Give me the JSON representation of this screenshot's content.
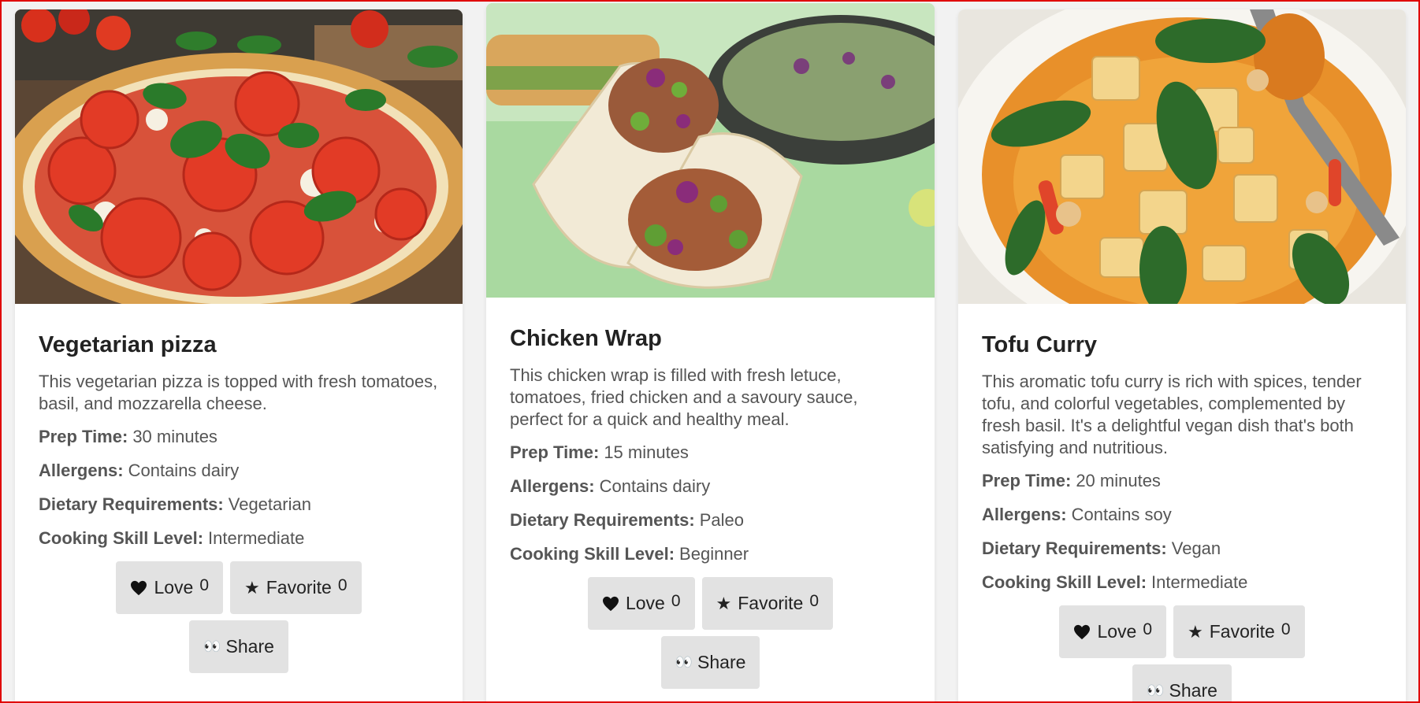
{
  "labels": {
    "prep": "Prep Time:",
    "allergens": "Allergens:",
    "diet": "Dietary Requirements:",
    "skill": "Cooking Skill Level:",
    "love": "Love",
    "favorite": "Favorite",
    "share": "Share"
  },
  "recipes": [
    {
      "title": "Vegetarian pizza",
      "description": "This vegetarian pizza is topped with fresh tomatoes, basil, and mozzarella cheese.",
      "prep_time": "30 minutes",
      "allergens": "Contains dairy",
      "dietary": "Vegetarian",
      "skill": "Intermediate",
      "love_count": "0",
      "favorite_count": "0",
      "image_icon": "pizza-photo"
    },
    {
      "title": "Chicken Wrap",
      "description": "This chicken wrap is filled with fresh letuce, tomatoes, fried chicken and a savoury sauce, perfect for a quick and healthy meal.",
      "prep_time": "15 minutes",
      "allergens": "Contains dairy",
      "dietary": "Paleo",
      "skill": "Beginner",
      "love_count": "0",
      "favorite_count": "0",
      "image_icon": "wrap-photo"
    },
    {
      "title": "Tofu Curry",
      "description": "This aromatic tofu curry is rich with spices, tender tofu, and colorful vegetables, complemented by fresh basil. It's a delightful vegan dish that's both satisfying and nutritious.",
      "prep_time": "20 minutes",
      "allergens": "Contains soy",
      "dietary": "Vegan",
      "skill": "Intermediate",
      "love_count": "0",
      "favorite_count": "0",
      "image_icon": "curry-photo"
    }
  ],
  "icons": {
    "love": "heart-icon",
    "favorite": "star-icon",
    "share": "eyes-icon"
  },
  "colors": {
    "button_bg": "#e2e2e2",
    "card_bg": "#ffffff",
    "page_bg": "#f2f2f2",
    "frame": "#e00000"
  }
}
